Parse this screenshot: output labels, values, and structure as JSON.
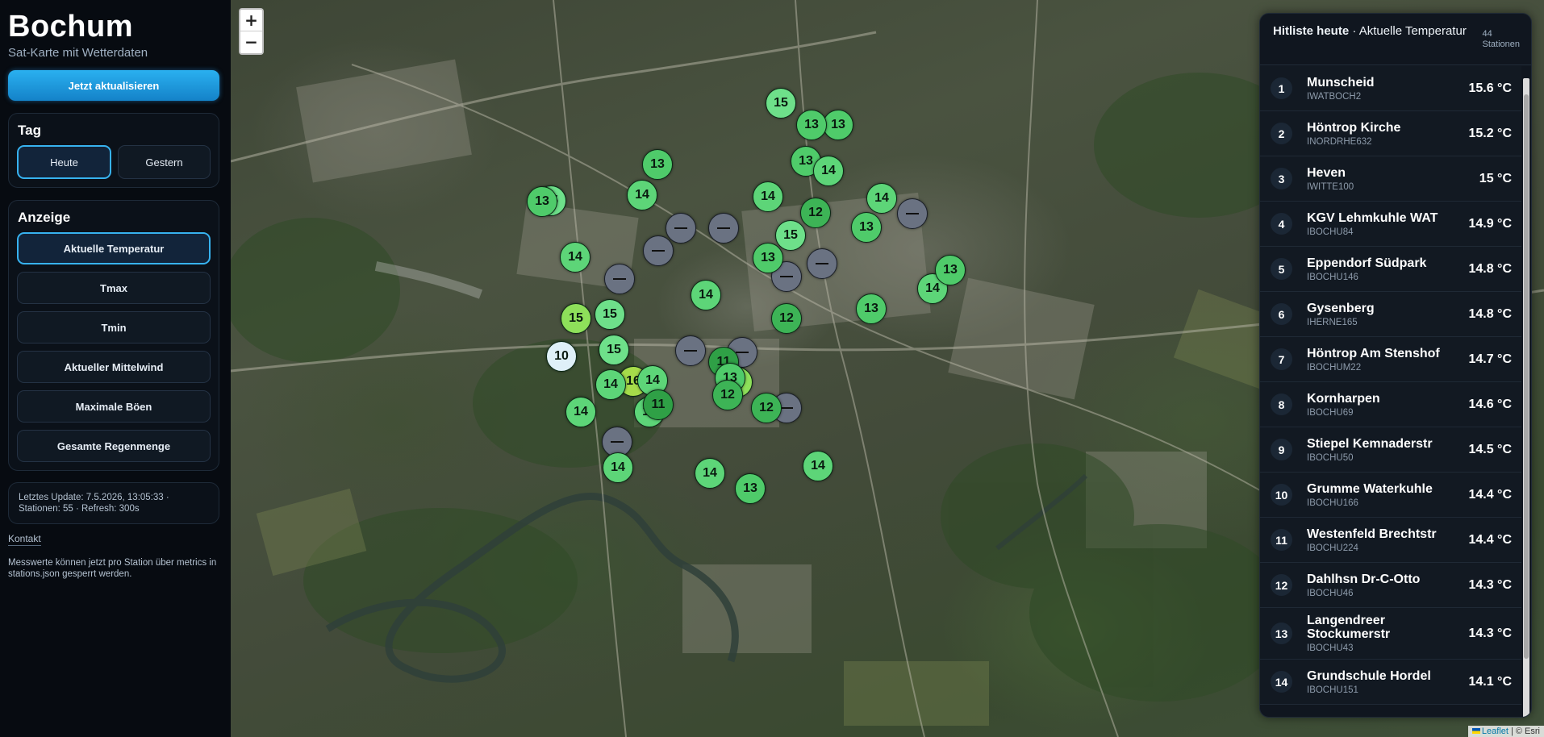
{
  "sidebar": {
    "title": "Bochum",
    "subtitle": "Sat-Karte mit Wetterdaten",
    "refresh_label": "Jetzt aktualisieren",
    "tag_heading": "Tag",
    "tag_today": "Heute",
    "tag_yesterday": "Gestern",
    "display_heading": "Anzeige",
    "options": [
      "Aktuelle Temperatur",
      "Tmax",
      "Tmin",
      "Aktueller Mittelwind",
      "Maximale Böen",
      "Gesamte Regenmenge"
    ],
    "status_line1": "Letztes Update: 7.5.2026, 13:05:33 ·",
    "status_line2": "Stationen: 55 · Refresh: 300s",
    "contact": "Kontakt",
    "note": "Messwerte können jetzt pro Station über metrics in stations.json gesperrt werden."
  },
  "map": {
    "zoom_in": "+",
    "zoom_out": "−",
    "attribution_leaflet": "Leaflet",
    "attribution_rest": "| © Esri",
    "markers": [
      {
        "v": "15",
        "c": "#6ee08a"
      },
      {
        "v": "13",
        "c": "#4fcb6a"
      },
      {
        "v": "13",
        "c": "#4fcb6a"
      },
      {
        "v": "13",
        "c": "#4fcb6a"
      },
      {
        "v": "13",
        "c": "#4fcb6a"
      },
      {
        "v": "14",
        "c": "#5dd578"
      },
      {
        "v": "14",
        "c": "#5dd578"
      },
      {
        "v": "12",
        "c": "#3db456"
      },
      {
        "v": "14",
        "c": "#5dd578"
      },
      {
        "v": "14",
        "c": "#5dd578"
      },
      {
        "v": "13",
        "c": "#4fcb6a"
      },
      {
        "v": "",
        "c": "na"
      },
      {
        "v": "15",
        "c": "#6ee08a"
      },
      {
        "v": "",
        "c": "na"
      },
      {
        "v": "",
        "c": "na"
      },
      {
        "v": "15",
        "c": "#6ee08a"
      },
      {
        "v": "14",
        "c": "#5dd578"
      },
      {
        "v": "",
        "c": "na"
      },
      {
        "v": "13",
        "c": "#4fcb6a"
      },
      {
        "v": "",
        "c": "na"
      },
      {
        "v": "",
        "c": "na"
      },
      {
        "v": "",
        "c": "na"
      },
      {
        "v": "13",
        "c": "#4fcb6a"
      },
      {
        "v": "14",
        "c": "#5dd578"
      },
      {
        "v": "14",
        "c": "#5dd578"
      },
      {
        "v": "13",
        "c": "#4fcb6a"
      },
      {
        "v": "15",
        "c": "#8ee05a"
      },
      {
        "v": "15",
        "c": "#6ee08a"
      },
      {
        "v": "12",
        "c": "#3db456"
      },
      {
        "v": "13",
        "c": "#4fcb6a"
      },
      {
        "v": "10",
        "c": "#dff0f8"
      },
      {
        "v": "15",
        "c": "#6ee08a"
      },
      {
        "v": "",
        "c": "na"
      },
      {
        "v": "",
        "c": "na"
      },
      {
        "v": "11",
        "c": "#2fa046"
      },
      {
        "v": "15",
        "c": "#8ee05a"
      },
      {
        "v": "16",
        "c": "#a6dc4a"
      },
      {
        "v": "14",
        "c": "#5dd578"
      },
      {
        "v": "14",
        "c": "#5dd578"
      },
      {
        "v": "13",
        "c": "#4fcb6a"
      },
      {
        "v": "12",
        "c": "#3db456"
      },
      {
        "v": "14",
        "c": "#5dd578"
      },
      {
        "v": "14",
        "c": "#5dd578"
      },
      {
        "v": "11",
        "c": "#2fa046"
      },
      {
        "v": "",
        "c": "na"
      },
      {
        "v": "12",
        "c": "#3db456"
      },
      {
        "v": "",
        "c": "na"
      },
      {
        "v": "14",
        "c": "#5dd578"
      },
      {
        "v": "14",
        "c": "#5dd578"
      },
      {
        "v": "14",
        "c": "#5dd578"
      },
      {
        "v": "13",
        "c": "#4fcb6a"
      }
    ]
  },
  "ranking": {
    "title_bold": "Hitliste heute",
    "title_rest": " · Aktuelle Temperatur",
    "count_value": "44",
    "count_label": "Stationen",
    "rows": [
      {
        "rank": "1",
        "name": "Munscheid",
        "id": "IWATBOCH2",
        "value": "15.6 °C"
      },
      {
        "rank": "2",
        "name": "Höntrop Kirche",
        "id": "INORDRHE632",
        "value": "15.2 °C"
      },
      {
        "rank": "3",
        "name": "Heven",
        "id": "IWITTE100",
        "value": "15 °C"
      },
      {
        "rank": "4",
        "name": "KGV Lehmkuhle WAT",
        "id": "IBOCHU84",
        "value": "14.9 °C"
      },
      {
        "rank": "5",
        "name": "Eppendorf Südpark",
        "id": "IBOCHU146",
        "value": "14.8 °C"
      },
      {
        "rank": "6",
        "name": "Gysenberg",
        "id": "IHERNE165",
        "value": "14.8 °C"
      },
      {
        "rank": "7",
        "name": "Höntrop Am Stenshof",
        "id": "IBOCHUM22",
        "value": "14.7 °C"
      },
      {
        "rank": "8",
        "name": "Kornharpen",
        "id": "IBOCHU69",
        "value": "14.6 °C"
      },
      {
        "rank": "9",
        "name": "Stiepel Kemnaderstr",
        "id": "IBOCHU50",
        "value": "14.5 °C"
      },
      {
        "rank": "10",
        "name": "Grumme Waterkuhle",
        "id": "IBOCHU166",
        "value": "14.4 °C"
      },
      {
        "rank": "11",
        "name": "Westenfeld Brechtstr",
        "id": "IBOCHU224",
        "value": "14.4 °C"
      },
      {
        "rank": "12",
        "name": "Dahlhsn Dr-C-Otto",
        "id": "IBOCHU46",
        "value": "14.3 °C"
      },
      {
        "rank": "13",
        "name": "Langendreer Stockumerstr",
        "id": "IBOCHU43",
        "value": "14.3 °C"
      },
      {
        "rank": "14",
        "name": "Grundschule Hordel",
        "id": "IBOCHU151",
        "value": "14.1 °C"
      }
    ]
  }
}
